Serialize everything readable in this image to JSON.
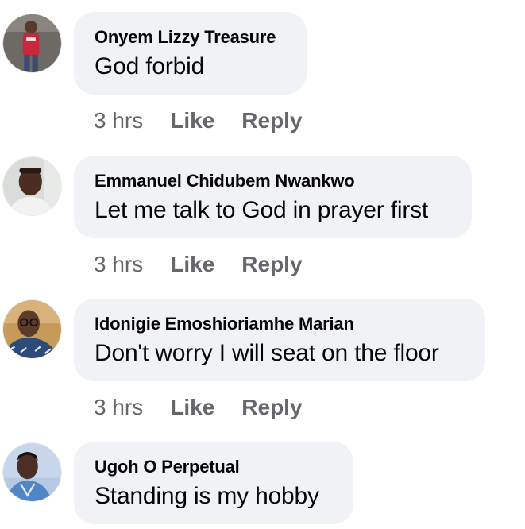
{
  "comments": [
    {
      "author": "Onyem Lizzy Treasure",
      "text": "God forbid",
      "time": "3 hrs",
      "like_label": "Like",
      "reply_label": "Reply",
      "avatar_colors": {
        "bg": "#6d6a66",
        "shirt": "#c8283a",
        "skin": "#5a3a2c"
      }
    },
    {
      "author": "Emmanuel Chidubem Nwankwo",
      "text": "Let me talk to God in prayer first",
      "time": "3 hrs",
      "like_label": "Like",
      "reply_label": "Reply",
      "avatar_colors": {
        "bg": "#d9dcd8",
        "shirt": "#f2f2f2",
        "skin": "#4a2e22"
      }
    },
    {
      "author": "Idonigie Emoshioriamhe Marian",
      "text": "Don't worry I will seat on the floor",
      "time": "3 hrs",
      "like_label": "Like",
      "reply_label": "Reply",
      "avatar_colors": {
        "bg": "#c79a5a",
        "shirt": "#2c4a7a",
        "skin": "#5b3b2a"
      }
    },
    {
      "author": "Ugoh O Perpetual",
      "text": "Standing is my hobby",
      "time": "",
      "like_label": "",
      "reply_label": "",
      "avatar_colors": {
        "bg": "#c7d6ea",
        "shirt": "#4f86c6",
        "skin": "#4b2f24"
      }
    }
  ],
  "colors": {
    "bubble_bg": "#f0f2f5",
    "text": "#050505",
    "meta": "#65676b"
  }
}
